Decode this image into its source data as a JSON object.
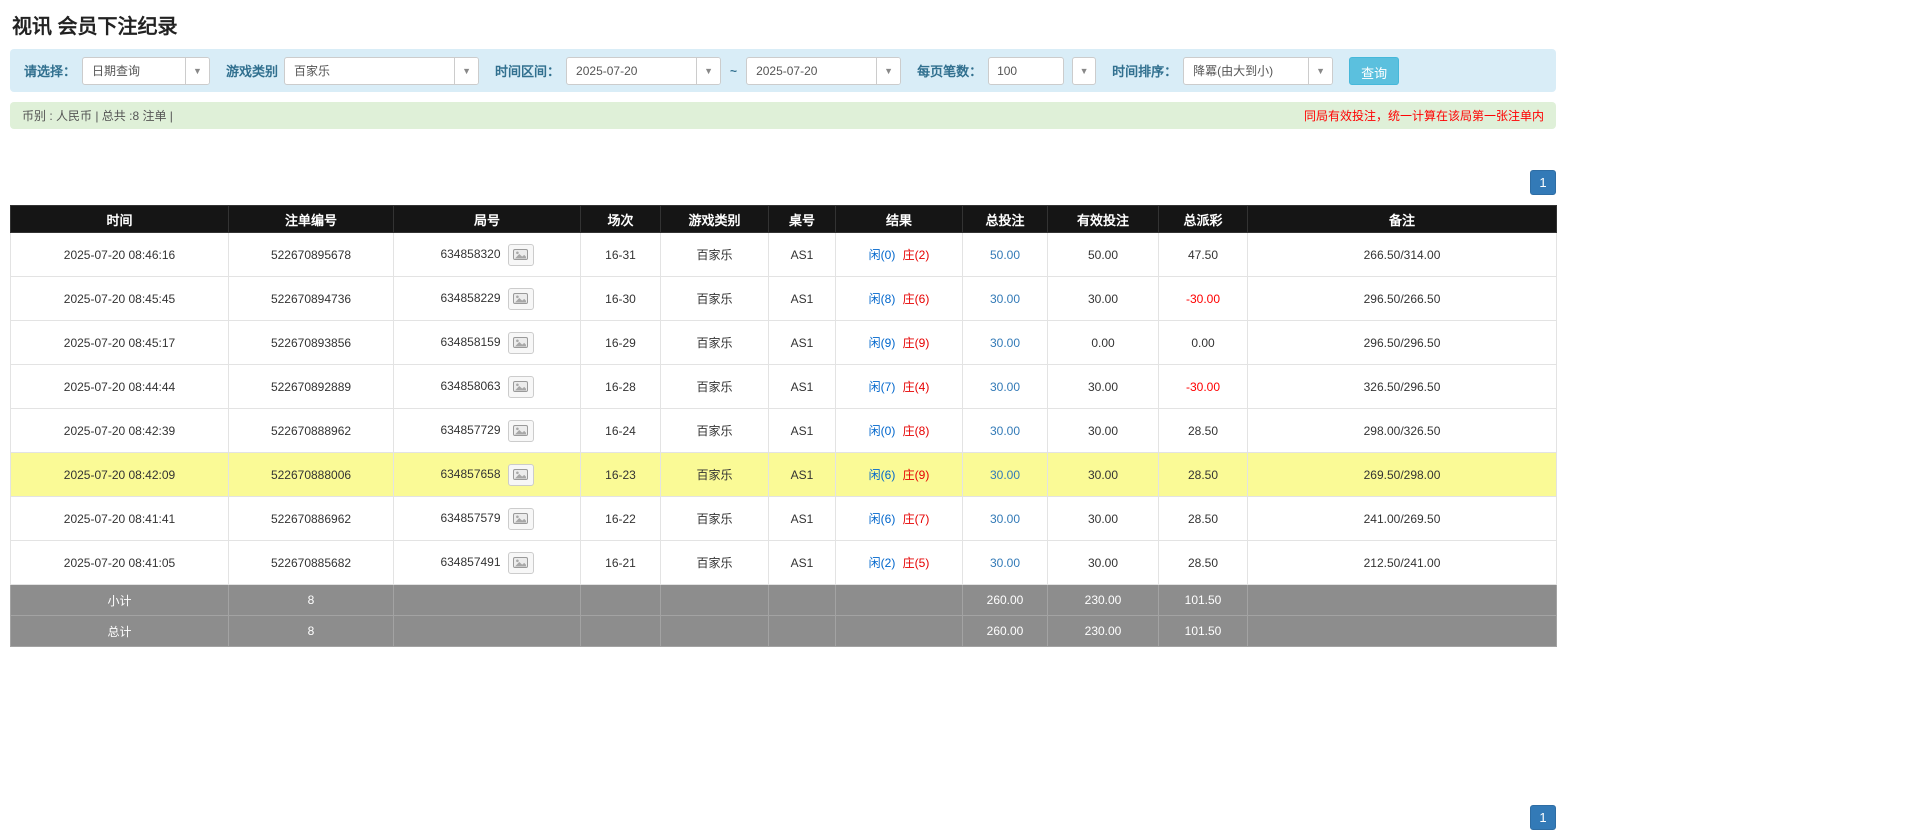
{
  "page": {
    "title": "视讯 会员下注纪录"
  },
  "colors": {
    "accent_button": "#5bc0de",
    "pagination": "#337ab7",
    "player_blue": "#0066cc",
    "banker_red": "#e60000",
    "negative_red": "#ff0000",
    "highlight_row": "#fafa96",
    "filter_bg": "#d9edf7",
    "summary_bg": "#dff0d8",
    "header_bg": "#151515",
    "footer_bg": "#8d8d8d"
  },
  "filters": {
    "select_label": "请选择：",
    "select_value": "日期查询",
    "game_type_label": "游戏类别",
    "game_type_value": "百家乐",
    "time_range_label": "时间区间：",
    "date_from": "2025-07-20",
    "tilde": "~",
    "date_to": "2025-07-20",
    "page_size_label": "每页笔数：",
    "page_size_value": "100",
    "sort_label": "时间排序：",
    "sort_value": "降冪(由大到小)",
    "search_button": "查询"
  },
  "summary": {
    "left": "币别 : 人民币 | 总共 :8 注单 |",
    "right": "同局有效投注，统一计算在该局第一张注单内"
  },
  "pagination": {
    "page": "1"
  },
  "table": {
    "headers": [
      "时间",
      "注单编号",
      "局号",
      "场次",
      "游戏类别",
      "桌号",
      "结果",
      "总投注",
      "有效投注",
      "总派彩",
      "备注"
    ],
    "rows": [
      {
        "time": "2025-07-20 08:46:16",
        "bet_id": "522670895678",
        "round_id": "634858320",
        "session": "16-31",
        "game": "百家乐",
        "table_no": "AS1",
        "result_player": "闲(0)",
        "result_banker": "庄(2)",
        "total_bet": "50.00",
        "valid_bet": "50.00",
        "payout": "47.50",
        "note": "266.50/314.00",
        "highlighted": false
      },
      {
        "time": "2025-07-20 08:45:45",
        "bet_id": "522670894736",
        "round_id": "634858229",
        "session": "16-30",
        "game": "百家乐",
        "table_no": "AS1",
        "result_player": "闲(8)",
        "result_banker": "庄(6)",
        "total_bet": "30.00",
        "valid_bet": "30.00",
        "payout": "-30.00",
        "note": "296.50/266.50",
        "highlighted": false
      },
      {
        "time": "2025-07-20 08:45:17",
        "bet_id": "522670893856",
        "round_id": "634858159",
        "session": "16-29",
        "game": "百家乐",
        "table_no": "AS1",
        "result_player": "闲(9)",
        "result_banker": "庄(9)",
        "total_bet": "30.00",
        "valid_bet": "0.00",
        "payout": "0.00",
        "note": "296.50/296.50",
        "highlighted": false
      },
      {
        "time": "2025-07-20 08:44:44",
        "bet_id": "522670892889",
        "round_id": "634858063",
        "session": "16-28",
        "game": "百家乐",
        "table_no": "AS1",
        "result_player": "闲(7)",
        "result_banker": "庄(4)",
        "total_bet": "30.00",
        "valid_bet": "30.00",
        "payout": "-30.00",
        "note": "326.50/296.50",
        "highlighted": false
      },
      {
        "time": "2025-07-20 08:42:39",
        "bet_id": "522670888962",
        "round_id": "634857729",
        "session": "16-24",
        "game": "百家乐",
        "table_no": "AS1",
        "result_player": "闲(0)",
        "result_banker": "庄(8)",
        "total_bet": "30.00",
        "valid_bet": "30.00",
        "payout": "28.50",
        "note": "298.00/326.50",
        "highlighted": false
      },
      {
        "time": "2025-07-20 08:42:09",
        "bet_id": "522670888006",
        "round_id": "634857658",
        "session": "16-23",
        "game": "百家乐",
        "table_no": "AS1",
        "result_player": "闲(6)",
        "result_banker": "庄(9)",
        "total_bet": "30.00",
        "valid_bet": "30.00",
        "payout": "28.50",
        "note": "269.50/298.00",
        "highlighted": true
      },
      {
        "time": "2025-07-20 08:41:41",
        "bet_id": "522670886962",
        "round_id": "634857579",
        "session": "16-22",
        "game": "百家乐",
        "table_no": "AS1",
        "result_player": "闲(6)",
        "result_banker": "庄(7)",
        "total_bet": "30.00",
        "valid_bet": "30.00",
        "payout": "28.50",
        "note": "241.00/269.50",
        "highlighted": false
      },
      {
        "time": "2025-07-20 08:41:05",
        "bet_id": "522670885682",
        "round_id": "634857491",
        "session": "16-21",
        "game": "百家乐",
        "table_no": "AS1",
        "result_player": "闲(2)",
        "result_banker": "庄(5)",
        "total_bet": "30.00",
        "valid_bet": "30.00",
        "payout": "28.50",
        "note": "212.50/241.00",
        "highlighted": false
      }
    ],
    "footer": [
      {
        "label": "小计",
        "count": "8",
        "total_bet": "260.00",
        "valid_bet": "230.00",
        "payout": "101.50"
      },
      {
        "label": "总计",
        "count": "8",
        "total_bet": "260.00",
        "valid_bet": "230.00",
        "payout": "101.50"
      }
    ]
  }
}
